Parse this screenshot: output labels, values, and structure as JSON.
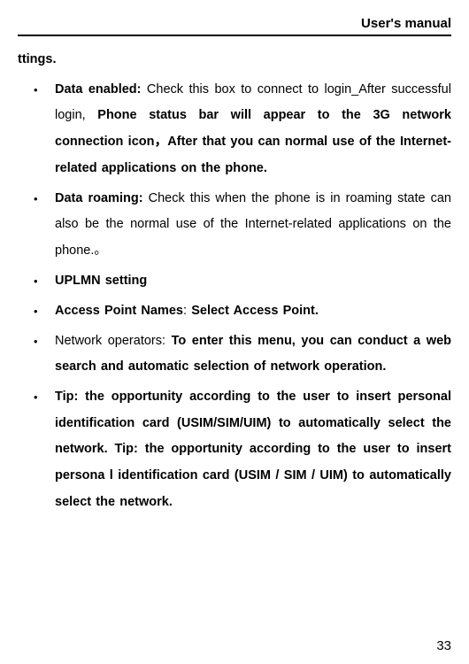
{
  "header": "User's manual",
  "section_title": "ttings.",
  "items": [
    {
      "label": "Data enabled:",
      "label_class": "b",
      "body": "Check this box to connect to login_After successful login,",
      "body_class": "r",
      "tail": "Phone status bar will appear to the 3G network connection icon，After that you can normal use of the Internet-related applications on the phone.",
      "tail_class": "b"
    },
    {
      "label": "Data roaming:",
      "label_class": "b",
      "body": "Check this when the phone is in roaming state can also be the normal use of the Internet-related applications on the phone.。",
      "body_class": "r",
      "tail": "",
      "tail_class": ""
    },
    {
      "label": "UPLMN setting",
      "label_class": "b",
      "body": "",
      "body_class": "",
      "tail": "",
      "tail_class": ""
    },
    {
      "label": "Access Point Names",
      "label_class": "b",
      "body": ":",
      "body_class": "r",
      "tail": "Select Access Point.",
      "tail_class": "b"
    },
    {
      "label": "Network operators:",
      "label_class": "r",
      "body": "",
      "body_class": "",
      "tail": "To enter this menu, you can conduct a web search and automatic selection of network operation.",
      "tail_class": "b"
    },
    {
      "label": "",
      "label_class": "",
      "body": "",
      "body_class": "",
      "tail": "Tip: the opportunity according to the user to insert personal identification card (USIM/SIM/UIM) to automatically select the network. Tip: the opportunity according to the user to insert persona l identification card (USIM / SIM / UIM) to automatically select the network.",
      "tail_class": "b"
    }
  ],
  "page_number": "33"
}
